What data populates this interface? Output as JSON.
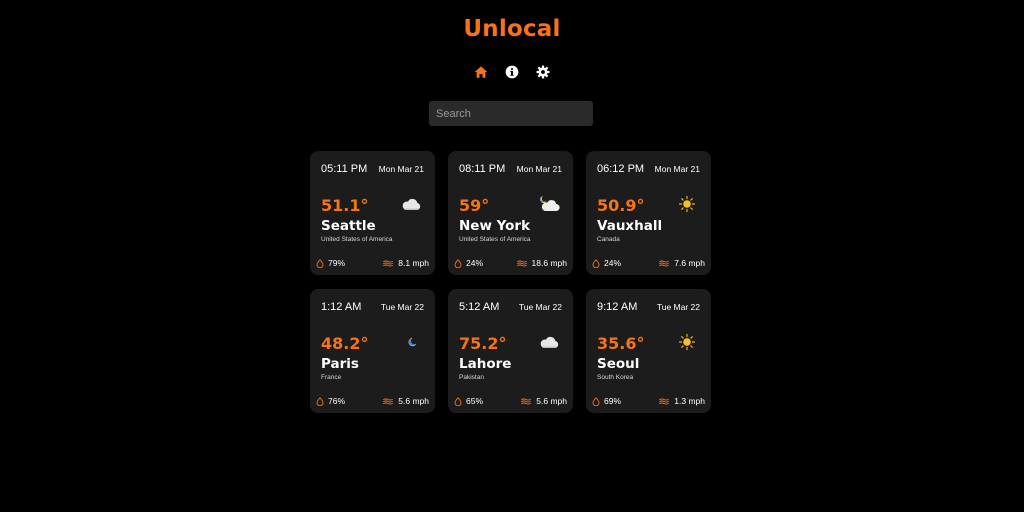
{
  "app": {
    "title": "Unlocal",
    "nav": [
      {
        "name": "home-icon",
        "icon": "home",
        "active": true
      },
      {
        "name": "info-icon",
        "icon": "info",
        "active": false
      },
      {
        "name": "settings-icon",
        "icon": "gear",
        "active": false
      }
    ],
    "search": {
      "placeholder": "Search",
      "value": ""
    },
    "colors": {
      "accent": "#f97316",
      "card": "#1c1c1c",
      "background": "#000000"
    }
  },
  "cards": [
    {
      "time": "05:11 PM",
      "date": "Mon Mar 21",
      "temp": "51.1°",
      "city": "Seattle",
      "country": "United States of America",
      "humidity": "79%",
      "wind": "8.1 mph",
      "icon": "cloud"
    },
    {
      "time": "08:11 PM",
      "date": "Mon Mar 21",
      "temp": "59°",
      "city": "New York",
      "country": "United States of America",
      "humidity": "24%",
      "wind": "18.6 mph",
      "icon": "moon-cloud"
    },
    {
      "time": "06:12 PM",
      "date": "Mon Mar 21",
      "temp": "50.9°",
      "city": "Vauxhall",
      "country": "Canada",
      "humidity": "24%",
      "wind": "7.6 mph",
      "icon": "sun"
    },
    {
      "time": "1:12 AM",
      "date": "Tue Mar 22",
      "temp": "48.2°",
      "city": "Paris",
      "country": "France",
      "humidity": "76%",
      "wind": "5.6 mph",
      "icon": "moon"
    },
    {
      "time": "5:12 AM",
      "date": "Tue Mar 22",
      "temp": "75.2°",
      "city": "Lahore",
      "country": "Pakistan",
      "humidity": "65%",
      "wind": "5.6 mph",
      "icon": "cloud"
    },
    {
      "time": "9:12 AM",
      "date": "Tue Mar 22",
      "temp": "35.6°",
      "city": "Seoul",
      "country": "South Korea",
      "humidity": "69%",
      "wind": "1.3 mph",
      "icon": "sun"
    }
  ]
}
